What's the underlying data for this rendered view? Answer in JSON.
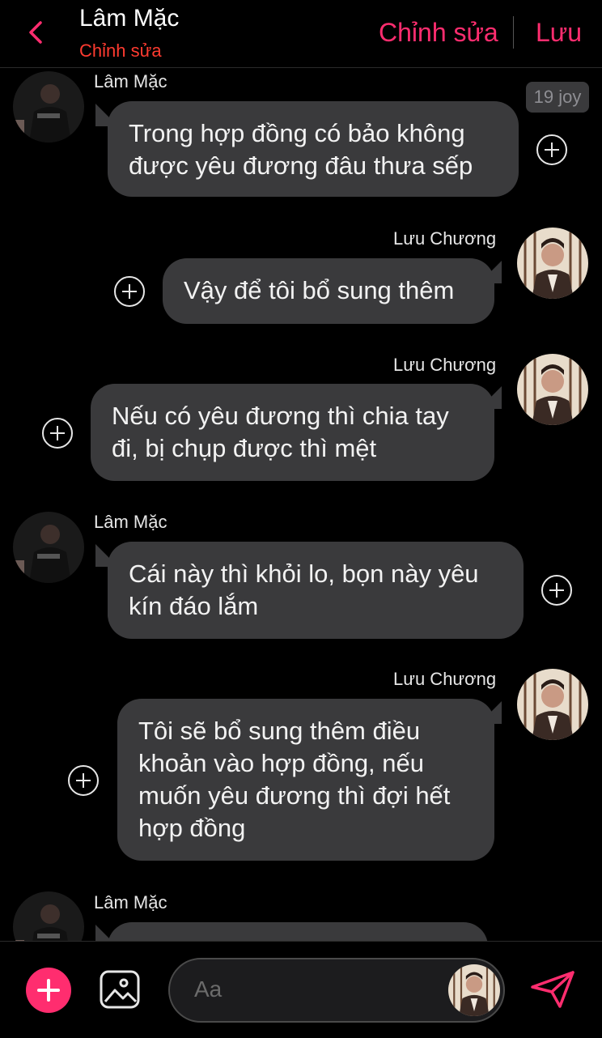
{
  "header": {
    "title": "Lâm Mặc",
    "subtitle": "Chỉnh sửa",
    "edit_label": "Chỉnh sửa",
    "save_label": "Lưu"
  },
  "messages": [
    {
      "sender": "Lâm Mặc",
      "side": "left",
      "text": "Trong hợp đồng có bảo không được yêu đương đâu thưa sếp",
      "time": "19 joy"
    },
    {
      "sender": "Lưu Chương",
      "side": "right",
      "text": "Vậy để tôi bổ sung thêm"
    },
    {
      "sender": "Lưu Chương",
      "side": "right",
      "text": "Nếu có yêu đương thì chia tay đi, bị chụp được thì mệt"
    },
    {
      "sender": "Lâm Mặc",
      "side": "left",
      "text": "Cái này thì khỏi lo, bọn này yêu kín đáo lắm"
    },
    {
      "sender": "Lưu Chương",
      "side": "right",
      "text": "Tôi sẽ bổ sung thêm điều khoản vào hợp đồng, nếu muốn yêu đương thì đợi hết hợp đồng"
    },
    {
      "sender": "Lâm Mặc",
      "side": "left",
      "text": ""
    }
  ],
  "composer": {
    "placeholder": "Aa"
  },
  "colors": {
    "accent": "#ff2d6f",
    "subtitle": "#ff3b30",
    "bubble": "#3a3a3c",
    "background": "#000000"
  },
  "icons": [
    "back-chevron-icon",
    "plus-circle-icon",
    "add-icon",
    "image-icon",
    "send-icon"
  ]
}
